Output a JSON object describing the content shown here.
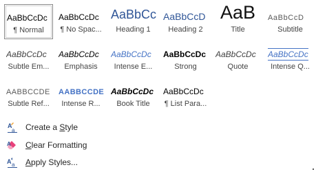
{
  "styles": {
    "row1": [
      {
        "preview": "AaBbCcDc",
        "label": "¶ Normal",
        "selected": true
      },
      {
        "preview": "AaBbCcDc",
        "label": "¶ No Spac..."
      },
      {
        "preview": "AaBbCc",
        "label": "Heading 1"
      },
      {
        "preview": "AaBbCcD",
        "label": "Heading 2"
      },
      {
        "preview": "AaB",
        "label": "Title"
      },
      {
        "preview": "AaBbCcD",
        "label": "Subtitle"
      }
    ],
    "row2": [
      {
        "preview": "AaBbCcDc",
        "label": "Subtle Em..."
      },
      {
        "preview": "AaBbCcDc",
        "label": "Emphasis"
      },
      {
        "preview": "AaBbCcDc",
        "label": "Intense E..."
      },
      {
        "preview": "AaBbCcDc",
        "label": "Strong"
      },
      {
        "preview": "AaBbCcDc",
        "label": "Quote"
      },
      {
        "preview": "AaBbCcDc",
        "label": "Intense Q..."
      }
    ],
    "row3": [
      {
        "preview": "AABBCCDE",
        "label": "Subtle Ref..."
      },
      {
        "preview": "AABBCCDE",
        "label": "Intense R..."
      },
      {
        "preview": "AaBbCcDc",
        "label": "Book Title"
      },
      {
        "preview": "AaBbCcDc",
        "label": "¶ List Para..."
      }
    ]
  },
  "commands": {
    "create_style": {
      "pre": "Create a ",
      "key": "S",
      "post": "tyle",
      "icon": "create-style-icon"
    },
    "clear_formatting": {
      "pre": "",
      "key": "C",
      "post": "lear Formatting",
      "icon": "clear-formatting-eraser-icon"
    },
    "apply_styles": {
      "pre": "",
      "key": "A",
      "post": "pply Styles...",
      "icon": "apply-styles-icon"
    }
  },
  "colors": {
    "heading_blue": "#2f5597",
    "accent_blue": "#4472c4",
    "eraser_pink": "#e8417a"
  }
}
